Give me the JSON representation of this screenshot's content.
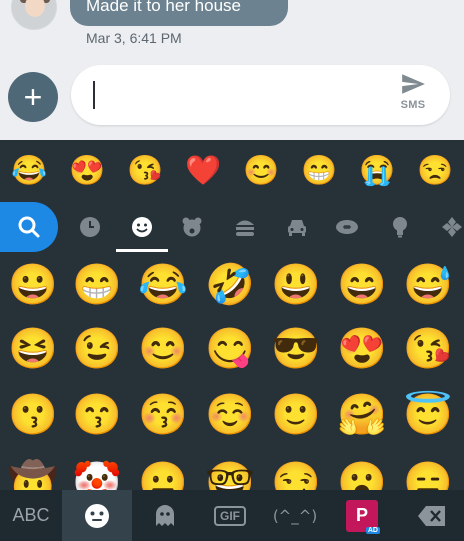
{
  "conversation": {
    "last_message": "Made it to her house",
    "timestamp": "Mar 3, 6:41 PM"
  },
  "composer": {
    "text": "",
    "send_label": "SMS"
  },
  "keyboard": {
    "recent_emojis": [
      "😂",
      "😍",
      "😘",
      "❤️",
      "😊",
      "😁",
      "😭",
      "😒"
    ],
    "categories": [
      "search",
      "recent",
      "smileys",
      "animals",
      "food",
      "travel",
      "activities",
      "objects",
      "symbols"
    ],
    "active_category": "smileys",
    "emoji_grid": [
      [
        "😀",
        "😁",
        "😂",
        "🤣",
        "😃",
        "😄",
        "😅"
      ],
      [
        "😆",
        "😉",
        "😊",
        "😋",
        "😎",
        "😍",
        "😘"
      ],
      [
        "😗",
        "😙",
        "😚",
        "☺️",
        "🙂",
        "🤗",
        "😇"
      ],
      [
        "🤠",
        "🤡",
        "😐",
        "🤓",
        "😏",
        "😮",
        "😑"
      ]
    ],
    "bottom_bar": {
      "abc_label": "ABC",
      "gif_label": "GIF",
      "kaomoji_label": "(^_^)",
      "sticker_ad_label": "AD"
    }
  },
  "colors": {
    "keyboard_bg": "#263238",
    "accent": "#1e88e5",
    "bubble": "#6c8290",
    "add_button": "#4f6877"
  }
}
